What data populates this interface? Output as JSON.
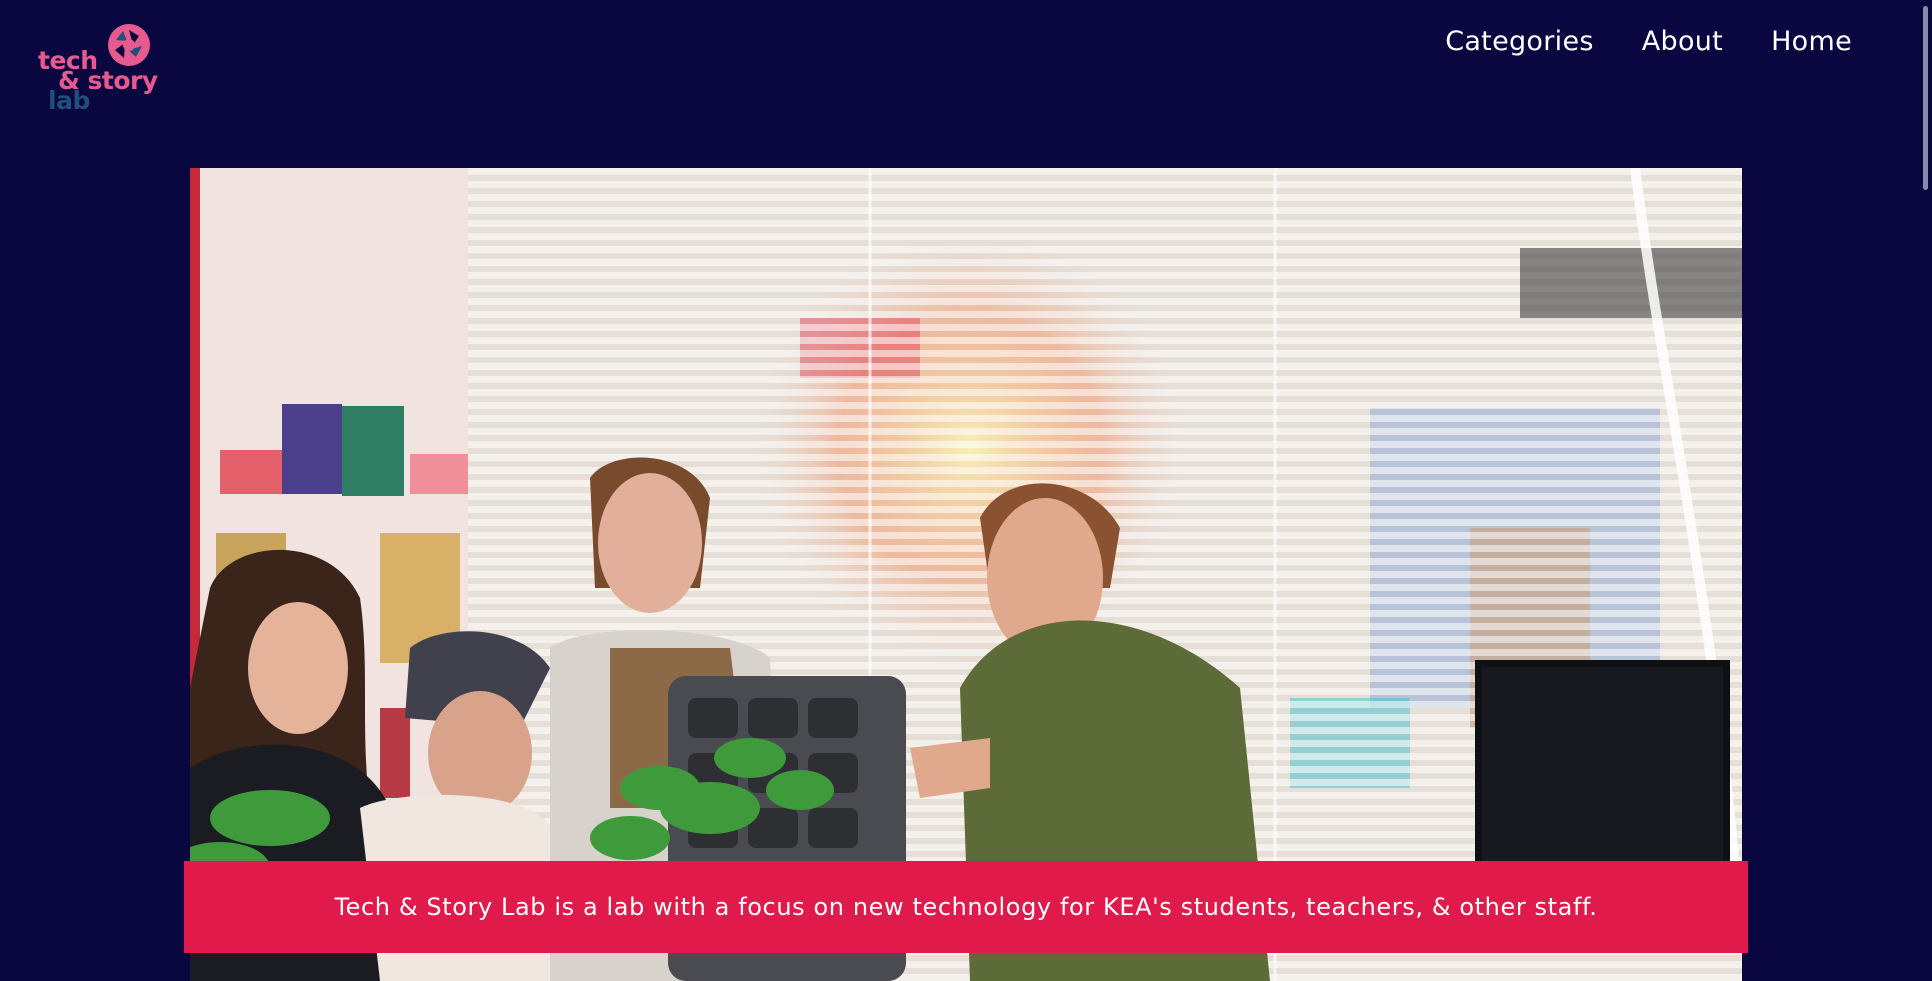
{
  "logo": {
    "line1": "tech",
    "line2": "& story",
    "line3": "lab",
    "icon": "aperture-icon",
    "colors": {
      "pink": "#e75a8f",
      "teal": "#1f4f7a"
    }
  },
  "nav": {
    "items": [
      {
        "label": "Categories"
      },
      {
        "label": "About"
      },
      {
        "label": "Home"
      }
    ]
  },
  "hero": {
    "image": "photo-people-in-lab-with-foam-packaging"
  },
  "banner": {
    "text": "Tech & Story Lab is a lab with a focus on new technology for KEA's students, teachers, & other staff."
  },
  "colors": {
    "background": "#0a0640",
    "banner": "#e01a4a",
    "nav_text": "#ffffff"
  }
}
